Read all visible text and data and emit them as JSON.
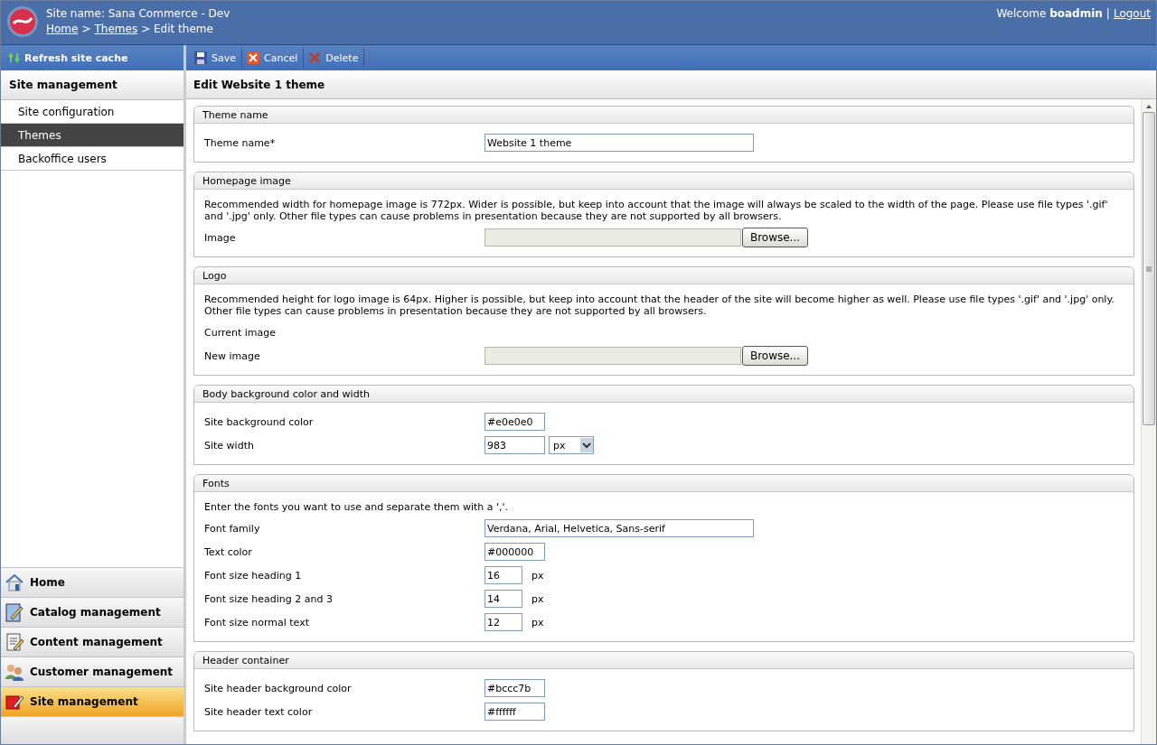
{
  "header": {
    "site_name": "Site name: Sana Commerce - Dev",
    "breadcrumb": [
      {
        "label": "Home",
        "link": true
      },
      {
        "label": ">",
        "link": false
      },
      {
        "label": "Themes",
        "link": true
      },
      {
        "label": "> Edit theme",
        "link": false
      }
    ],
    "welcome": "Welcome",
    "user": "boadmin",
    "separator": "|",
    "logout": "Logout"
  },
  "sidebar": {
    "refresh": "Refresh site cache",
    "heading": "Site management",
    "items": [
      {
        "label": "Site configuration",
        "selected": false
      },
      {
        "label": "Themes",
        "selected": true
      },
      {
        "label": "Backoffice users",
        "selected": false
      }
    ],
    "modules": [
      {
        "label": "Home",
        "kind": "home",
        "selected": false
      },
      {
        "label": "Catalog management",
        "kind": "catalog",
        "selected": false
      },
      {
        "label": "Content management",
        "kind": "content",
        "selected": false
      },
      {
        "label": "Customer management",
        "kind": "customer",
        "selected": false
      },
      {
        "label": "Site management",
        "kind": "site",
        "selected": true
      }
    ]
  },
  "toolbar": [
    {
      "label": "Save",
      "kind": "save"
    },
    {
      "label": "Cancel",
      "kind": "cancel"
    },
    {
      "label": "Delete",
      "kind": "delete"
    }
  ],
  "page_title": "Edit Website 1 theme",
  "sections": [
    {
      "title": "Theme name",
      "fields": [
        {
          "label": "Theme name*",
          "kind": "text",
          "value": "Website 1 theme"
        }
      ]
    },
    {
      "title": "Homepage image",
      "description": "Recommended width for homepage image is 772px. Wider is possible, but keep into account that the image will always be scaled to the width of the page. Please use file types '.gif' and '.jpg' only. Other file types can cause problems in presentation because they are not supported by all browsers.",
      "fields": [
        {
          "label": "Image",
          "kind": "file",
          "button": "Browse..."
        }
      ]
    },
    {
      "title": "Logo",
      "description": "Recommended height for logo image is 64px. Higher is possible, but keep into account that the header of the site will become higher as well. Please use file types '.gif' and '.jpg' only. Other file types can cause problems in presentation because they are not supported by all browsers.",
      "fields": [
        {
          "label": "Current image",
          "kind": "none"
        },
        {
          "label": "New image",
          "kind": "file",
          "button": "Browse..."
        }
      ]
    },
    {
      "title": "Body background color and width",
      "fields": [
        {
          "label": "Site background color",
          "kind": "color",
          "value": "#e0e0e0"
        },
        {
          "label": "Site width",
          "kind": "select",
          "value": "983",
          "option": "px"
        }
      ]
    },
    {
      "title": "Fonts",
      "description": "Enter the fonts you want to use and separate them with a ','.",
      "fields": [
        {
          "label": "Font family",
          "kind": "text",
          "value": "Verdana, Arial, Helvetica, Sans-serif"
        },
        {
          "label": "Text color",
          "kind": "color",
          "value": "#000000"
        },
        {
          "label": "Font size heading 1",
          "kind": "number",
          "value": "16",
          "unit": "px"
        },
        {
          "label": "Font size heading 2 and 3",
          "kind": "number",
          "value": "14",
          "unit": "px"
        },
        {
          "label": "Font size normal text",
          "kind": "number",
          "value": "12",
          "unit": "px"
        }
      ]
    },
    {
      "title": "Header container",
      "fields": [
        {
          "label": "Site header background color",
          "kind": "color",
          "value": "#bccc7b"
        },
        {
          "label": "Site header text color",
          "kind": "color",
          "value": "#ffffff"
        }
      ]
    }
  ]
}
